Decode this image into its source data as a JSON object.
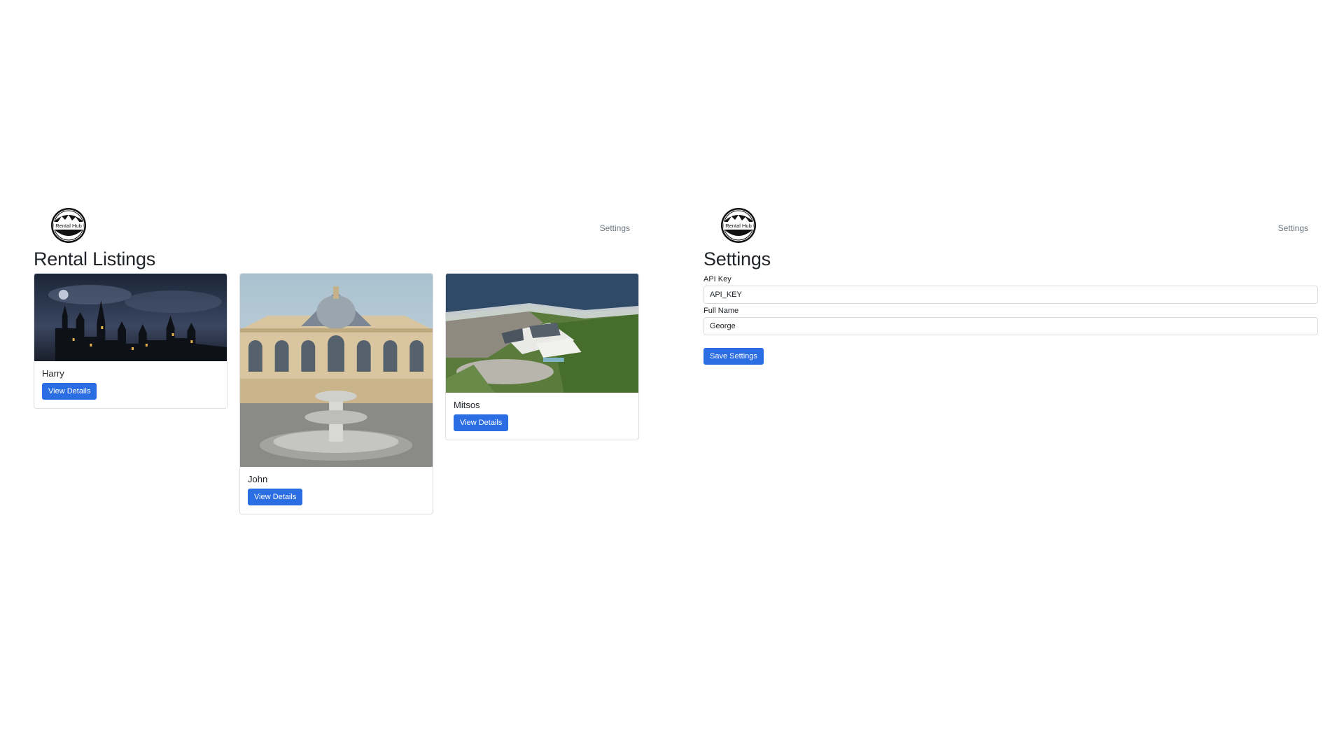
{
  "left": {
    "brand": {
      "logo_text": "Rental Hub"
    },
    "nav": {
      "settings_link": "Settings"
    },
    "page_title": "Rental Listings",
    "listings": [
      {
        "name": "Harry",
        "button_label": "View Details",
        "image": "castle-night"
      },
      {
        "name": "John",
        "button_label": "View Details",
        "image": "palace-fountain"
      },
      {
        "name": "Mitsos",
        "button_label": "View Details",
        "image": "coastal-mansion"
      }
    ]
  },
  "right": {
    "brand": {
      "logo_text": "Rental Hub"
    },
    "nav": {
      "settings_link": "Settings"
    },
    "page_title": "Settings",
    "form": {
      "api_key_label": "API Key",
      "api_key_value": "API_KEY",
      "full_name_label": "Full Name",
      "full_name_value": "George",
      "save_label": "Save Settings"
    }
  },
  "colors": {
    "primary_button": "#2b6de3",
    "nav_link": "#6c757d",
    "text": "#212529"
  }
}
